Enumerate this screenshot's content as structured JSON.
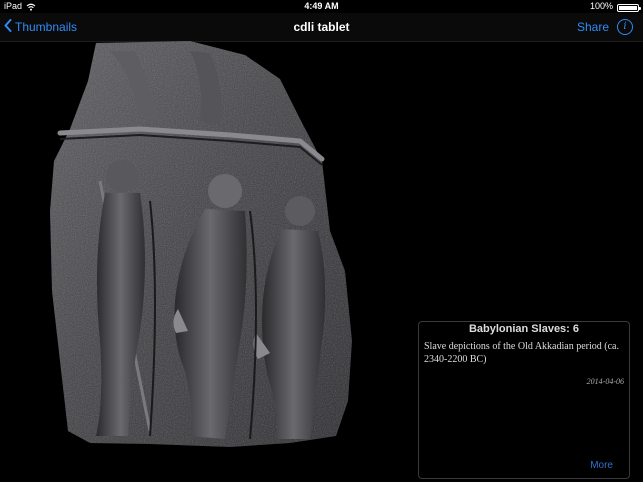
{
  "status_bar": {
    "device": "iPad",
    "time": "4:49 AM",
    "battery_percent": "100%",
    "battery_level": 1.0
  },
  "nav": {
    "back_label": "Thumbnails",
    "title": "cdli tablet",
    "share_label": "Share",
    "info_glyph": "i"
  },
  "icons": {
    "back": "chevron-left-icon",
    "wifi": "wifi-icon",
    "battery": "battery-icon",
    "info": "info-icon"
  },
  "colors": {
    "accent": "#2f8cf5",
    "background": "#000000",
    "nav_background": "#0a0a0a"
  },
  "info_panel": {
    "title": "Babylonian Slaves: 6",
    "description": "Slave depictions of the Old Akkadian period (ca. 2340-2200 BC)",
    "date": "2014-04-06",
    "more_label": "More"
  }
}
